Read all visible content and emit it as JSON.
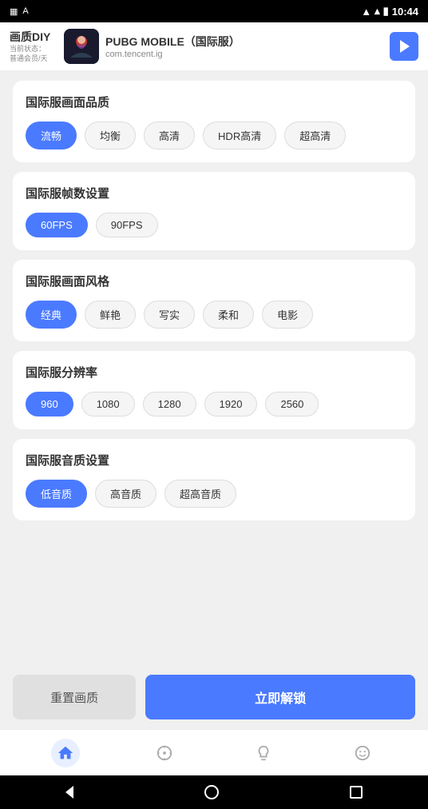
{
  "statusBar": {
    "time": "10:44"
  },
  "header": {
    "appTitle": "画质DIY",
    "statusLabel": "当前状态：",
    "memberLabel": "普通会员/天",
    "gameName": "PUBG MOBILE（国际服）",
    "gamePackage": "com.tencent.ig",
    "playBtnLabel": "▶"
  },
  "sections": [
    {
      "id": "quality",
      "title": "国际服画面品质",
      "options": [
        "流畅",
        "均衡",
        "高清",
        "HDR高清",
        "超高清"
      ],
      "activeIndex": 0
    },
    {
      "id": "fps",
      "title": "国际服帧数设置",
      "options": [
        "60FPS",
        "90FPS"
      ],
      "activeIndex": 0
    },
    {
      "id": "style",
      "title": "国际服画面风格",
      "options": [
        "经典",
        "鲜艳",
        "写实",
        "柔和",
        "电影"
      ],
      "activeIndex": 0
    },
    {
      "id": "resolution",
      "title": "国际服分辨率",
      "options": [
        "960",
        "1080",
        "1280",
        "1920",
        "2560"
      ],
      "activeIndex": 0
    },
    {
      "id": "audio",
      "title": "国际服音质设置",
      "options": [
        "低音质",
        "高音质",
        "超高音质"
      ],
      "activeIndex": 0
    }
  ],
  "buttons": {
    "reset": "重置画质",
    "unlock": "立即解锁"
  },
  "bottomNav": {
    "items": [
      {
        "id": "home",
        "active": true
      },
      {
        "id": "compass",
        "active": false
      },
      {
        "id": "lightbulb",
        "active": false
      },
      {
        "id": "smiley",
        "active": false
      }
    ]
  }
}
